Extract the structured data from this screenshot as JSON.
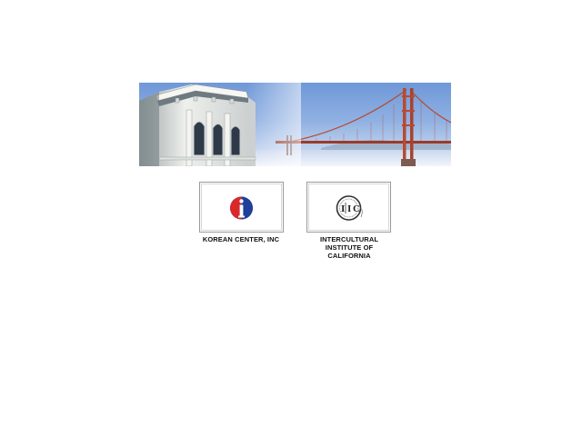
{
  "banner": {
    "image": "victorian-building-and-golden-gate-bridge",
    "colors": {
      "sky": "#7aa1dc",
      "bridge": "#b4452e",
      "building": "#e9ece8"
    }
  },
  "orgs": [
    {
      "name": "KOREAN CENTER, INC",
      "logo": "korean-center-logo",
      "colors": {
        "left": "#d8282b",
        "right": "#1e3f9a"
      }
    },
    {
      "name_lines": [
        "INTERCULTURAL",
        "INSTITUTE OF",
        "CALIFORNIA"
      ],
      "logo": "iic-logo",
      "logo_text": {
        "i1": "I",
        "i2": "I",
        "c": "C"
      },
      "colors": {
        "ink": "#333333"
      }
    }
  ]
}
